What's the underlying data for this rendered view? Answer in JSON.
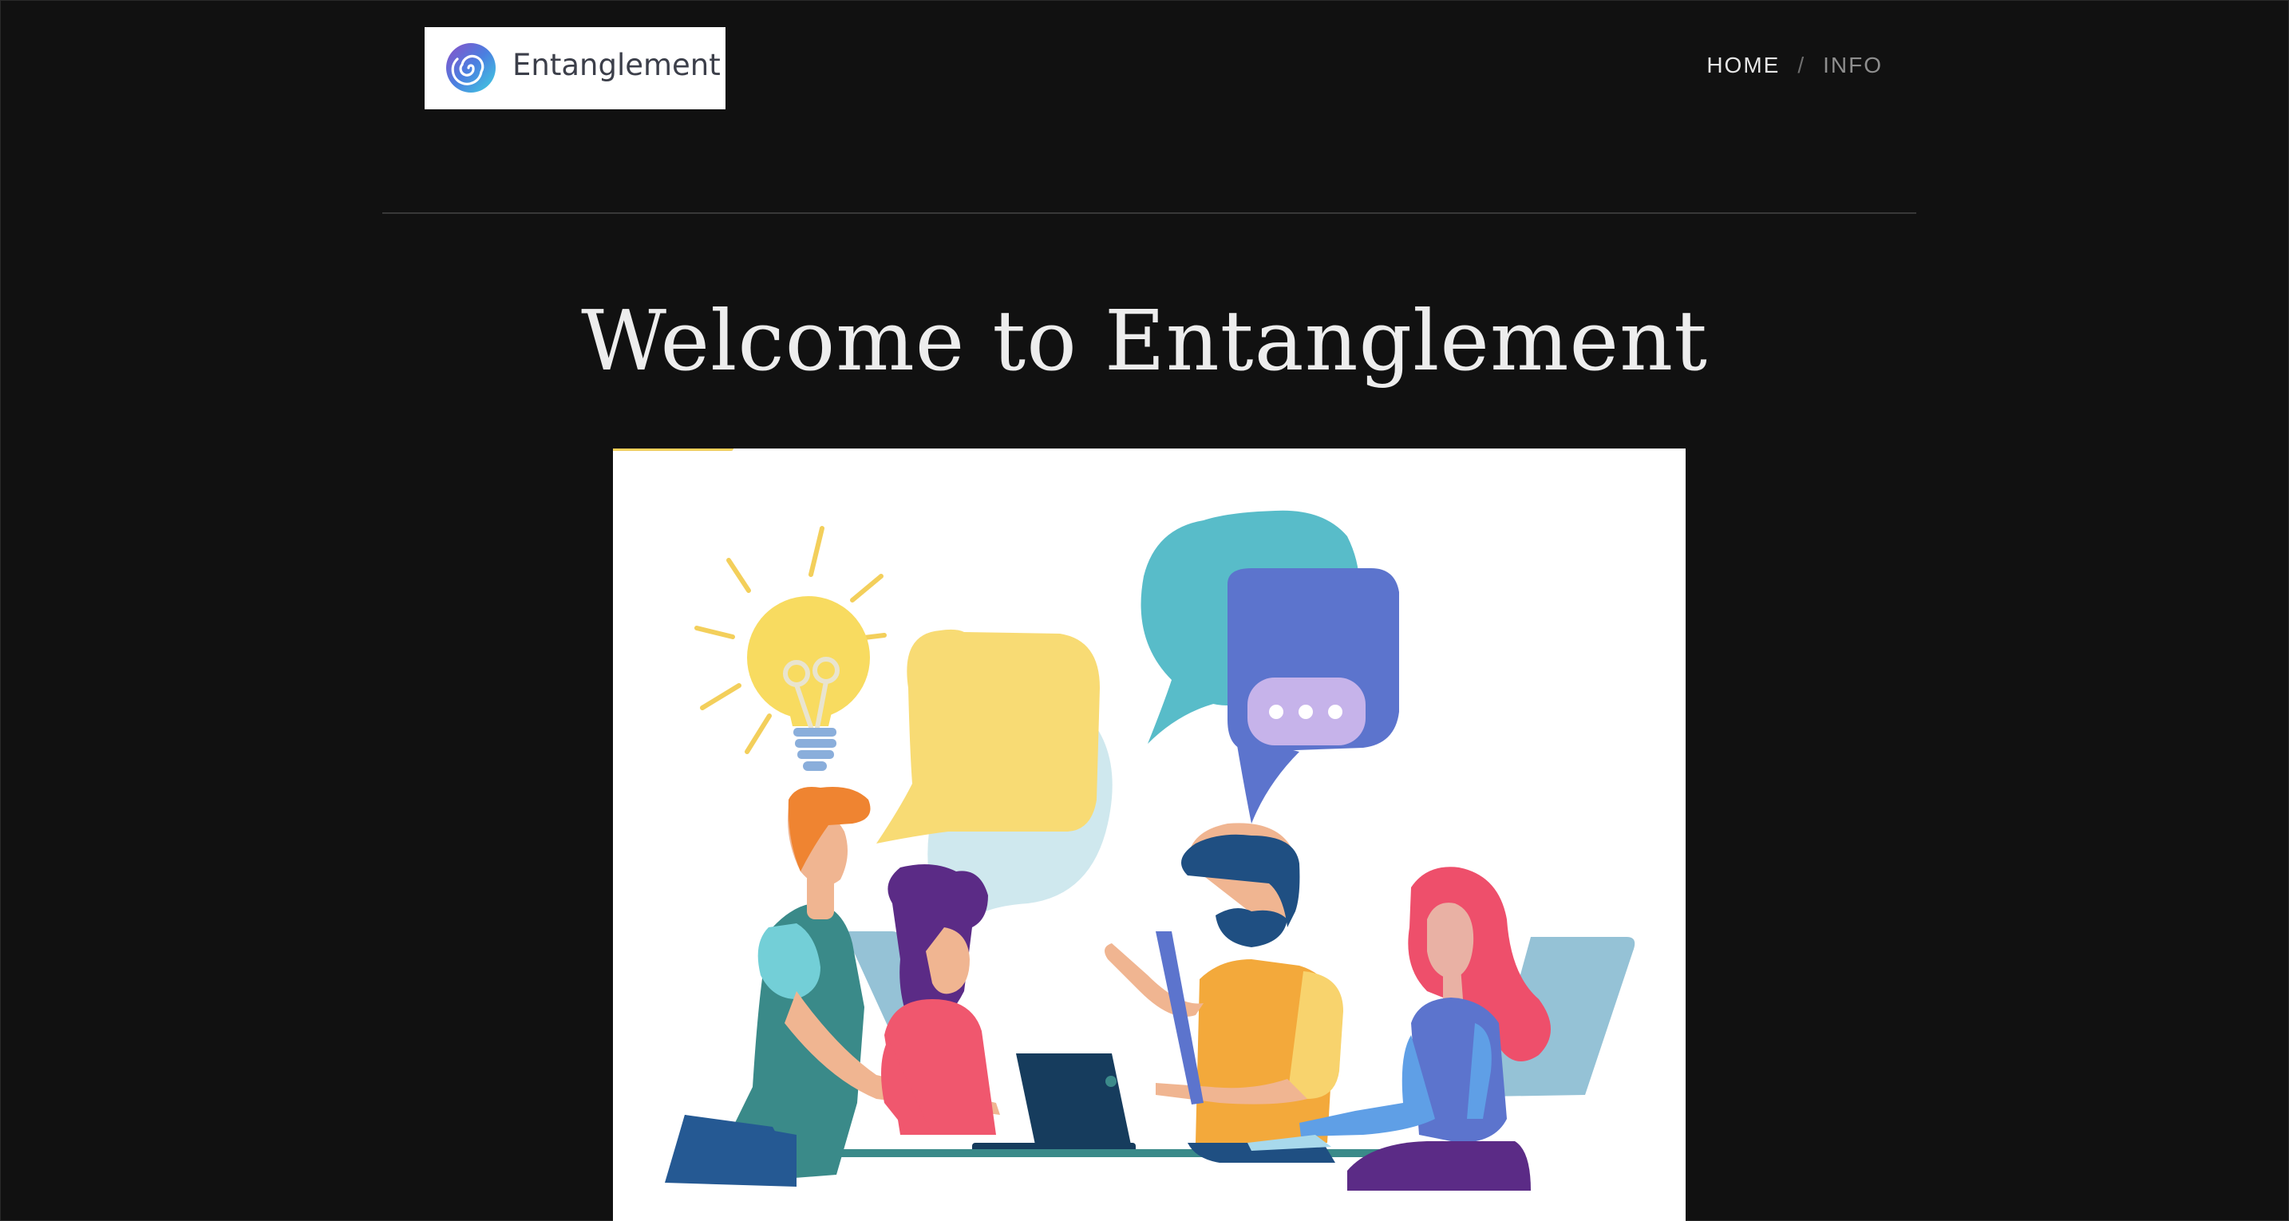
{
  "brand": {
    "name": "Entanglement",
    "logo_icon": "spiral-logo-icon"
  },
  "nav": {
    "items": [
      {
        "label": "HOME",
        "active": true
      },
      {
        "label": "INFO",
        "active": false
      }
    ],
    "separator": "/"
  },
  "main": {
    "title": "Welcome to Entanglement",
    "hero_image": "team-collaboration-illustration"
  },
  "colors": {
    "background": "#111111",
    "title": "#ededed",
    "nav_active": "#e6e6e6",
    "nav_inactive": "#8e8e8e"
  }
}
